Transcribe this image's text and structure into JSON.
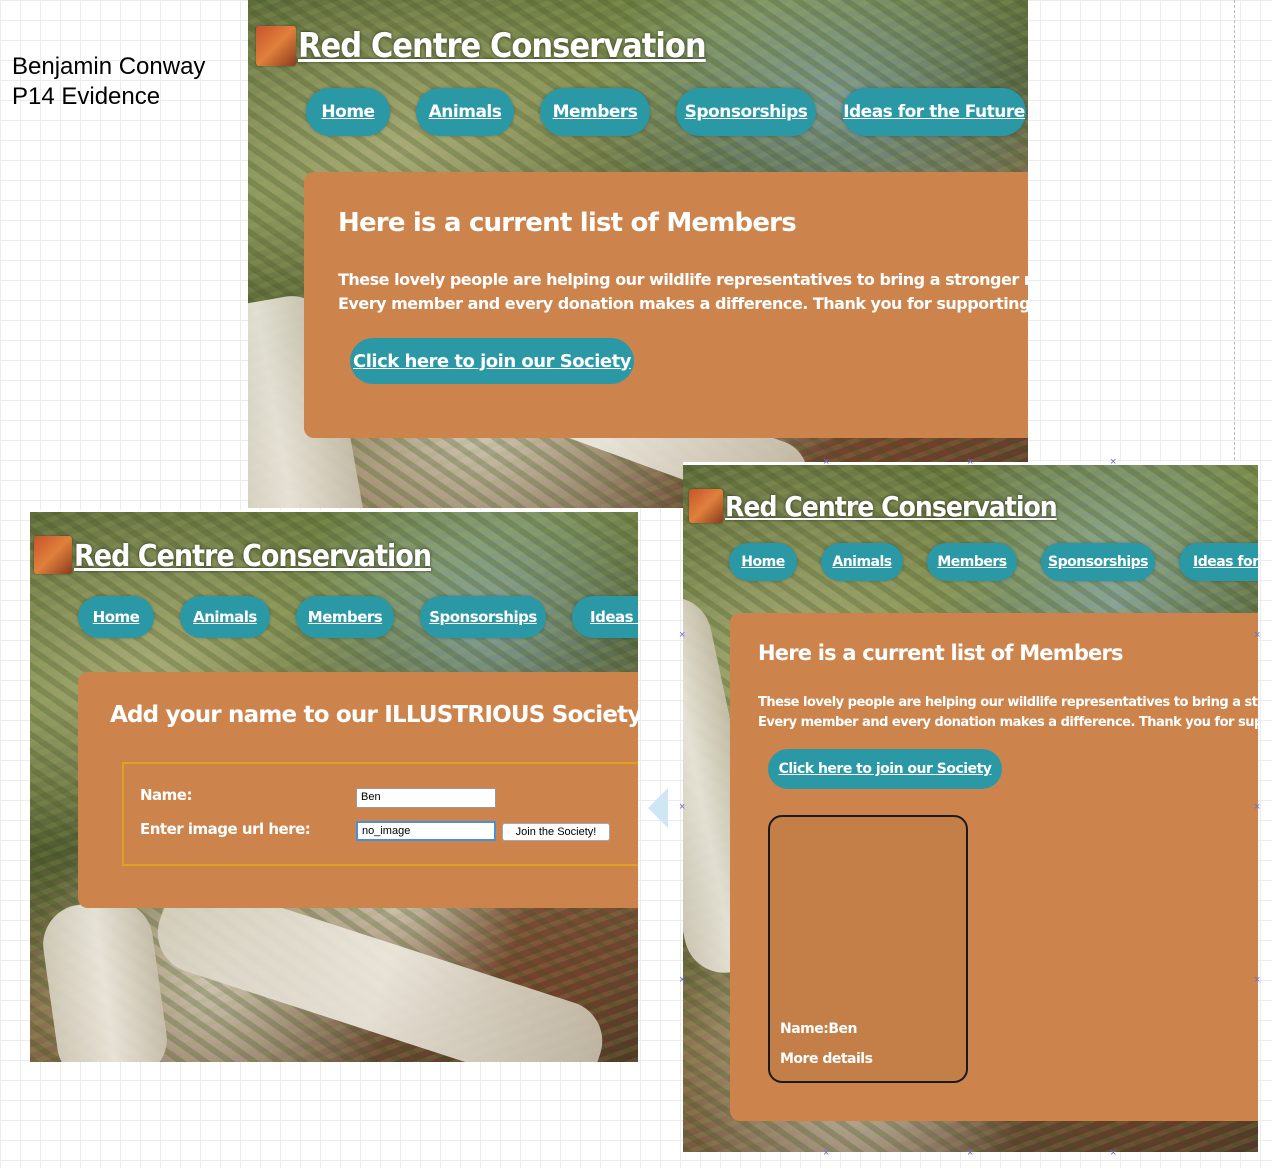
{
  "caption": {
    "line1": "Benjamin Conway",
    "line2": "P14 Evidence"
  },
  "site_title": "Red Centre Conservation",
  "nav": [
    "Home",
    "Animals",
    "Members",
    "Sponsorships",
    "Ideas for the Future"
  ],
  "nav_cut_left": "Ideas fo",
  "nav_cut_right": "Ideas for t",
  "members_page": {
    "heading": "Here is a current list of Members",
    "para1": "These lovely people are helping our wildlife representatives to bring a stronger more dynamic",
    "para2": "Every member and every donation makes a difference. Thank you for supporting our wild spac",
    "para1_short": "These lovely people are helping our wildlife representatives to bring a stronger mo",
    "para2_short": "Every member and every donation makes a difference. Thank you for supporting o",
    "join_link": "Click here to join our Society"
  },
  "join_page": {
    "heading": "Add your name to our ILLUSTRIOUS Society",
    "name_label": "Name:",
    "name_value": "Ben",
    "image_label": "Enter image url here:",
    "image_value": "no_image",
    "submit_label": "Join the Society!"
  },
  "member_card": {
    "name": "Name:Ben",
    "details": "More details"
  },
  "colors": {
    "accent": "#2b98a6",
    "card": "#cd844c",
    "text": "#ffffff",
    "form_border": "#e0a020"
  },
  "icons": {
    "logo": "red-rock-logo-icon",
    "selection_handle": "x-handle-icon"
  }
}
